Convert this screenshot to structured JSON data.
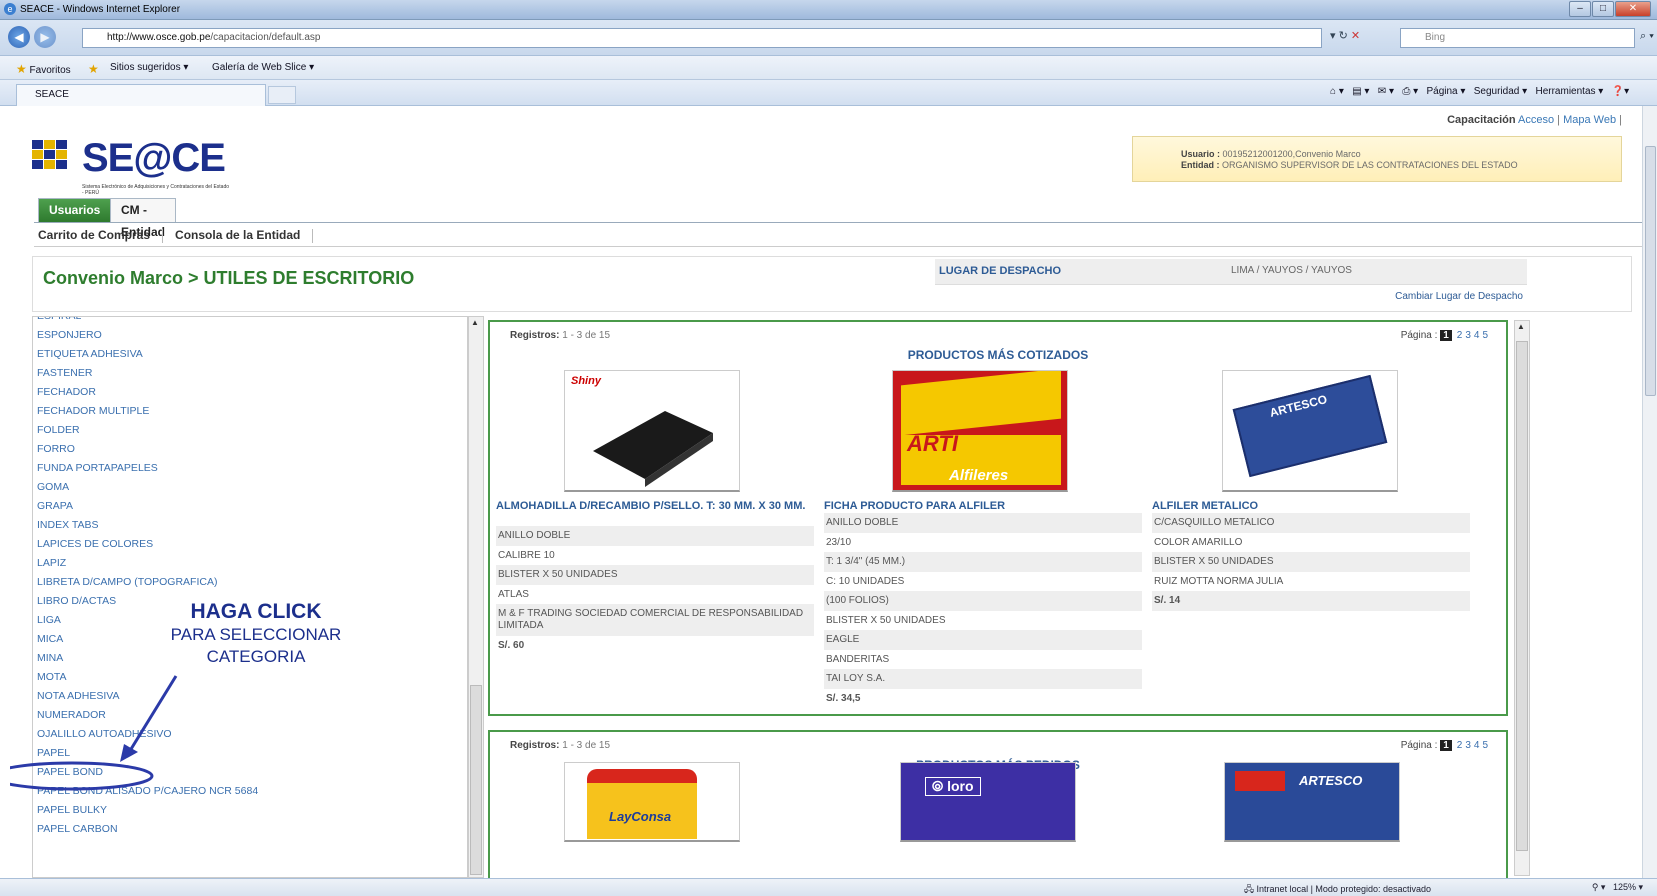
{
  "window": {
    "title": "SEACE - Windows Internet Explorer"
  },
  "address": {
    "url_domain": "http://www.osce.gob.pe",
    "url_path": "/capacitacion/default.asp",
    "search_placeholder": "Bing"
  },
  "favorites": {
    "label": "Favoritos",
    "suggested": "Sitios sugeridos ▾",
    "webslice": "Galería de Web Slice ▾"
  },
  "tab": {
    "title": "SEACE"
  },
  "commandbar": {
    "page": "Página ▾",
    "security": "Seguridad ▾",
    "tools": "Herramientas ▾"
  },
  "header": {
    "links": {
      "capacitacion": "Capacitación",
      "acceso": "Acceso",
      "mapa": "Mapa Web"
    },
    "logo": {
      "name": "SE@CE",
      "subtitle": "Sistema Electrónico de Adquisiciones y Contrataciones del Estado - PERÚ"
    },
    "user": {
      "label_user": "Usuario :",
      "user_value": "00195212001200,Convenio Marco",
      "label_entity": "Entidad :",
      "entity_value": "ORGANISMO SUPERVISOR DE LAS CONTRATACIONES DEL ESTADO"
    }
  },
  "tabs": {
    "usuarios": "Usuarios",
    "cm": "CM - Entidad"
  },
  "subnav": {
    "carrito": "Carrito de Compras",
    "consola": "Consola de la Entidad"
  },
  "breadcrumb": "Convenio Marco > UTILES DE ESCRITORIO",
  "lugar": {
    "label": "LUGAR DE DESPACHO",
    "value": "LIMA / YAUYOS / YAUYOS",
    "change": "Cambiar Lugar de Despacho"
  },
  "categories": [
    "ESPIRAL",
    "ESPONJERO",
    "ETIQUETA ADHESIVA",
    "FASTENER",
    "FECHADOR",
    "FECHADOR MULTIPLE",
    "FOLDER",
    "FORRO",
    "FUNDA PORTAPAPELES",
    "GOMA",
    "GRAPA",
    "INDEX TABS",
    "LAPICES DE COLORES",
    "LAPIZ",
    "LIBRETA D/CAMPO (TOPOGRAFICA)",
    "LIBRO D/ACTAS",
    "LIGA",
    "MICA",
    "MINA",
    "MOTA",
    "NOTA ADHESIVA",
    "NUMERADOR",
    "OJALILLO AUTOADHESIVO",
    "PAPEL",
    "PAPEL BOND",
    "PAPEL BOND ALISADO P/CAJERO NCR 5684",
    "PAPEL BULKY",
    "PAPEL CARBON"
  ],
  "annotation": {
    "heading": "HAGA CLICK",
    "line1": "PARA SELECCIONAR",
    "line2": "CATEGORIA"
  },
  "panel1": {
    "registros_label": "Registros:",
    "registros_value": "1 - 3 de 15",
    "pagina_label": "Página :",
    "pages": [
      "1",
      "2",
      "3",
      "4",
      "5"
    ],
    "title": "PRODUCTOS MÁS COTIZADOS",
    "products": [
      {
        "brand_logo": "Shiny",
        "name": "ALMOHADILLA D/RECAMBIO P/SELLO. T: 30 MM. X 30 MM.",
        "attrs": [
          "ANILLO DOBLE",
          "CALIBRE 10",
          "BLISTER X 50 UNIDADES",
          "ATLAS",
          "M & F TRADING SOCIEDAD COMERCIAL DE RESPONSABILIDAD LIMITADA",
          "S/. 60"
        ]
      },
      {
        "brand_logo": "ARTI Alfileres",
        "name": "FICHA PRODUCTO PARA ALFILER",
        "attrs": [
          "ANILLO DOBLE",
          "23/10",
          "T: 1 3/4\" (45 MM.)",
          "C: 10 UNIDADES",
          "(100 FOLIOS)",
          "BLISTER X 50 UNIDADES",
          "EAGLE",
          "BANDERITAS",
          "TAI LOY S.A.",
          "S/. 34,5"
        ]
      },
      {
        "brand_logo": "ARTESCO",
        "name": "ALFILER METALICO",
        "attrs": [
          "C/CASQUILLO METALICO",
          "COLOR AMARILLO",
          "BLISTER X 50 UNIDADES",
          "RUIZ MOTTA NORMA JULIA",
          "S/. 14"
        ]
      }
    ]
  },
  "panel2": {
    "registros_label": "Registros:",
    "registros_value": "1 - 3 de 15",
    "pagina_label": "Página :",
    "pages": [
      "1",
      "2",
      "3",
      "4",
      "5"
    ],
    "title": "PRODUCTOS MÁS PEDIDOS",
    "logos": [
      "LayConsa",
      "loro",
      "ARTESCO"
    ]
  },
  "status": {
    "zone": "Intranet local | Modo protegido: desactivado",
    "zoom": "125%"
  },
  "colors": {
    "accent_green": "#2e7d2e",
    "link_blue": "#3a6fae",
    "annotation_blue": "#1c2f8c"
  }
}
